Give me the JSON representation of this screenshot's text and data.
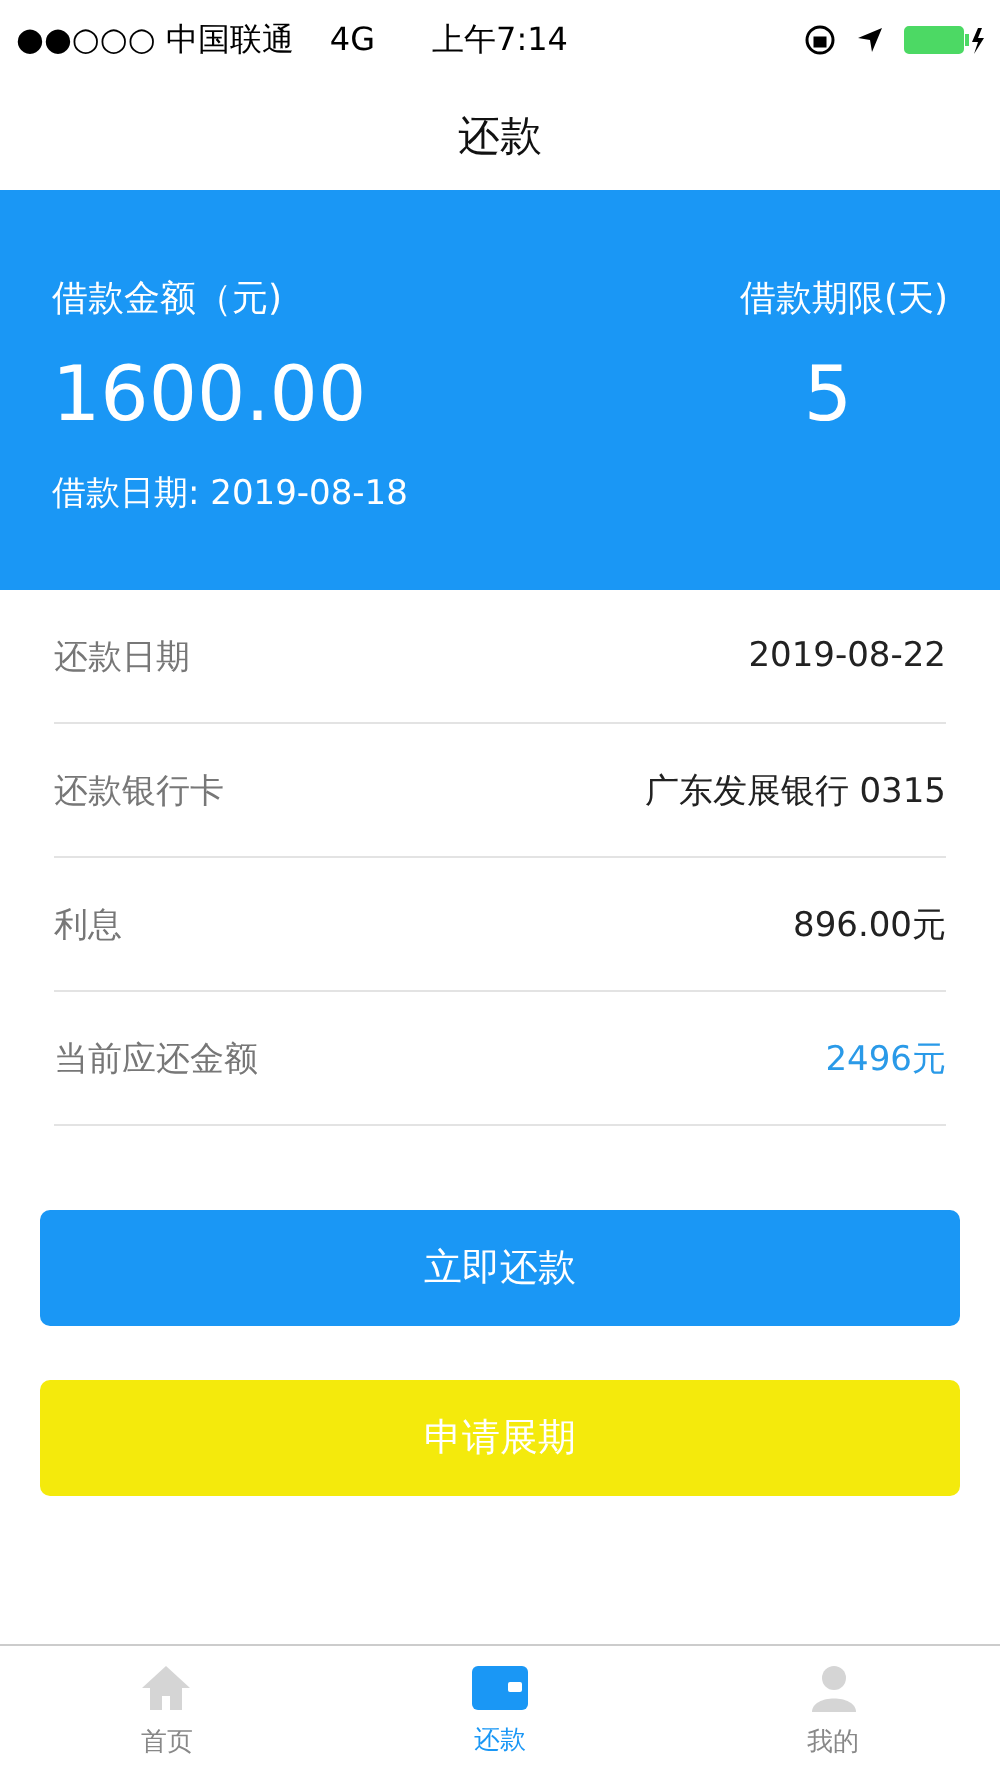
{
  "status_bar": {
    "carrier": "●●○○○ 中国联通",
    "network": "4G",
    "time": "上午7:14"
  },
  "nav": {
    "title": "还款"
  },
  "summary": {
    "amount_label": "借款金额（元)",
    "amount": "1600.00",
    "term_label": "借款期限(天)",
    "term": "5",
    "date": "借款日期: 2019-08-18"
  },
  "rows": [
    {
      "label": "还款日期",
      "value": "2019-08-22",
      "highlight": false
    },
    {
      "label": "还款银行卡",
      "value": "广东发展银行 0315",
      "highlight": false
    },
    {
      "label": "利息",
      "value": "896.00元",
      "highlight": false
    },
    {
      "label": "当前应还金额",
      "value": "2496元",
      "highlight": true
    }
  ],
  "buttons": [
    {
      "label": "立即还款",
      "kind": "primary"
    },
    {
      "label": "申请展期",
      "kind": "secondary"
    }
  ],
  "tabs": [
    {
      "label": "首页",
      "kind": "home",
      "selected": false
    },
    {
      "label": "还款",
      "kind": "wallet",
      "selected": true
    },
    {
      "label": "我的",
      "kind": "user",
      "selected": false
    }
  ]
}
